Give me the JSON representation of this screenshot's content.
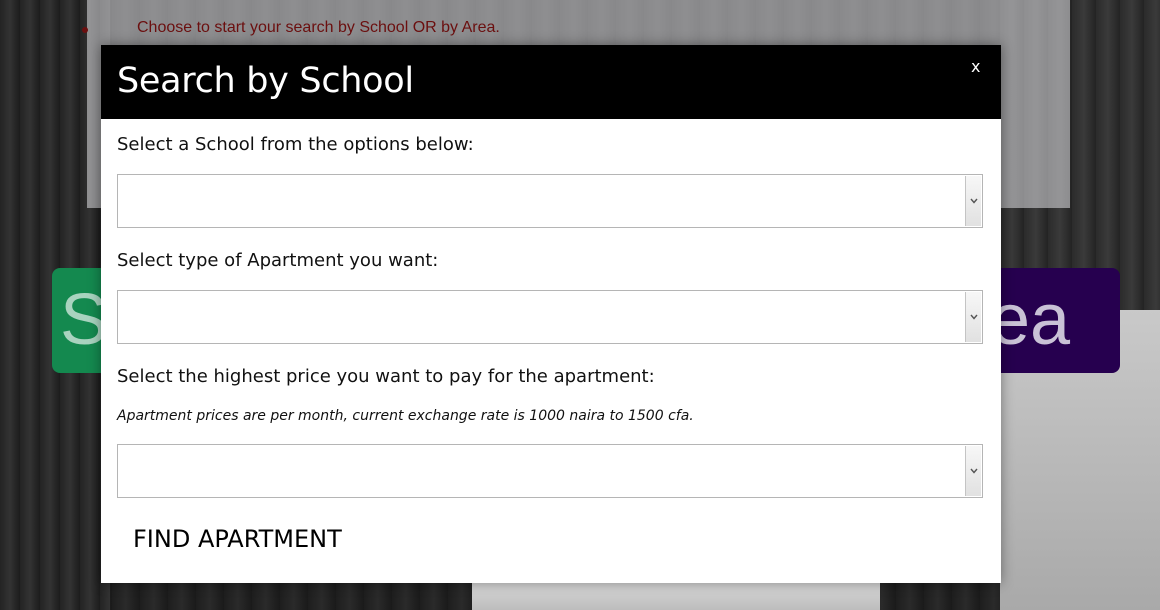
{
  "background": {
    "instruction": "Choose to start your search by School OR by Area.",
    "school_button_text": "S",
    "area_button_text": "ea"
  },
  "modal": {
    "title": "Search by School",
    "close_label": "x",
    "school_label": "Select a School from the options below:",
    "school_value": "",
    "apartment_label": "Select type of Apartment you want:",
    "apartment_value": "",
    "price_label": "Select the highest price you want to pay for the apartment:",
    "price_note": "Apartment prices are per month, current exchange rate is 1000 naira to 1500 cfa.",
    "price_value": "",
    "submit_label": "FIND APARTMENT"
  },
  "colors": {
    "modal_header": "#000000",
    "school_button": "#14894f",
    "area_button": "#26004f",
    "instruction_text": "#6b0f0f"
  }
}
